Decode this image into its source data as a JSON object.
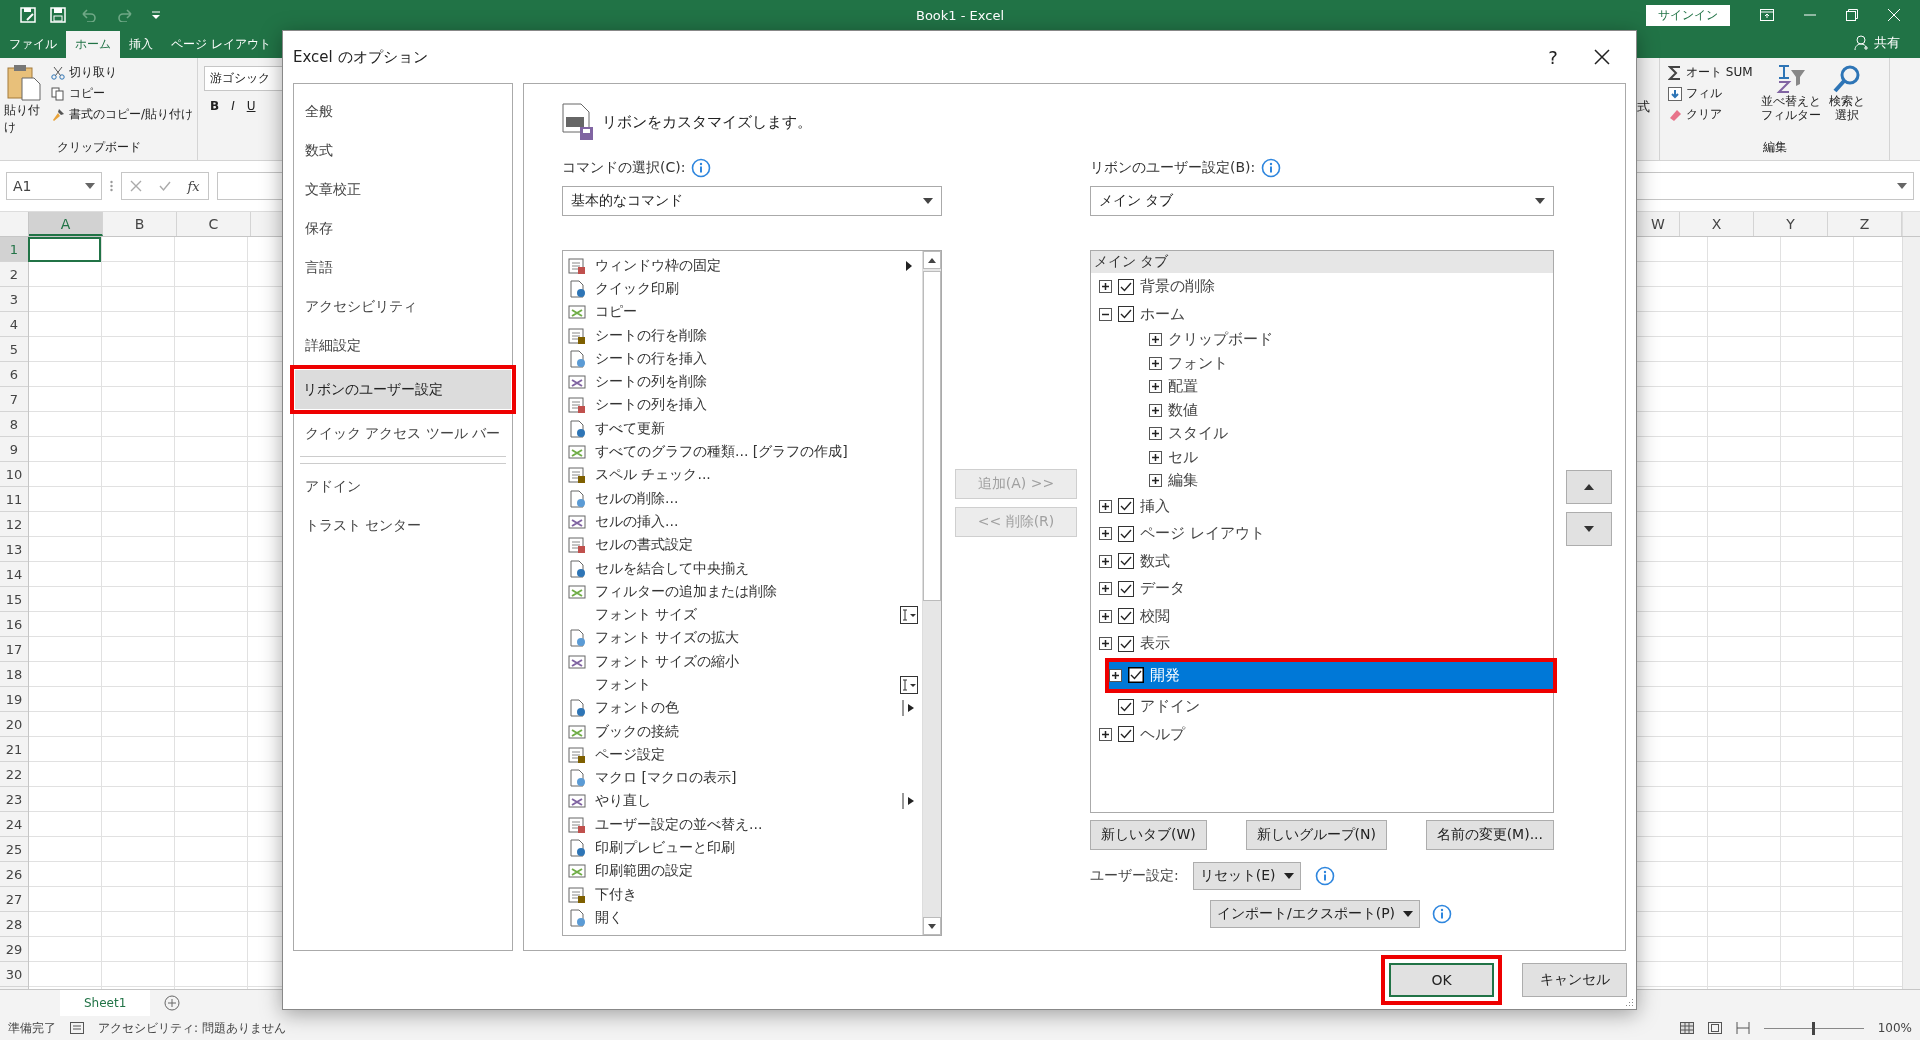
{
  "excel": {
    "title": "Book1  -  Excel",
    "signin": "サインイン",
    "share": "共有",
    "tabs": [
      {
        "label": "ファイル",
        "selected": false
      },
      {
        "label": "ホーム",
        "selected": true
      },
      {
        "label": "挿入",
        "selected": false
      },
      {
        "label": "ページ レイアウト",
        "selected": false
      }
    ],
    "clipboard": {
      "paste": "貼り付け",
      "cut": "切り取り",
      "copy": "コピー",
      "format_painter": "書式のコピー/貼り付け",
      "group": "クリップボード"
    },
    "font": {
      "name": "游ゴシック",
      "bold": "B",
      "italic": "I",
      "underline": "U"
    },
    "cells_fragment": "式",
    "editing": {
      "autosum": "オート SUM",
      "fill": "フィル",
      "clear": "クリア",
      "sort": [
        "並べ替えと",
        "フィルター"
      ],
      "find": [
        "検索と",
        "選択"
      ],
      "group": "編集"
    },
    "name_box": "A1",
    "function_label": "fx",
    "columns_left": [
      "A",
      "B",
      "C"
    ],
    "columns_right": [
      "W",
      "X",
      "Y",
      "Z"
    ],
    "rows": [
      "1",
      "2",
      "3",
      "4",
      "5",
      "6",
      "7",
      "8",
      "9",
      "10",
      "11",
      "12",
      "13",
      "14",
      "15",
      "16",
      "17",
      "18",
      "19",
      "20",
      "21",
      "22",
      "23",
      "24",
      "25",
      "26",
      "27",
      "28",
      "29",
      "30"
    ],
    "sheet_tab": "Sheet1",
    "status": {
      "ready": "準備完了",
      "accessibility": "アクセシビリティ: 問題ありません",
      "zoom": "100%",
      "zoom_slider": {
        "level": 0.5
      }
    }
  },
  "dialog": {
    "title": "Excel のオプション",
    "help": "?",
    "nav": [
      {
        "label": "全般",
        "selected": false,
        "highlighted": false
      },
      {
        "label": "数式",
        "selected": false,
        "highlighted": false
      },
      {
        "label": "文章校正",
        "selected": false,
        "highlighted": false
      },
      {
        "label": "保存",
        "selected": false,
        "highlighted": false
      },
      {
        "label": "言語",
        "selected": false,
        "highlighted": false
      },
      {
        "label": "アクセシビリティ",
        "selected": false,
        "highlighted": false
      },
      {
        "label": "詳細設定",
        "selected": false,
        "highlighted": false
      },
      {
        "label": "リボンのユーザー設定",
        "selected": true,
        "highlighted": true
      },
      {
        "label": "クイック アクセス ツール バー",
        "selected": false,
        "highlighted": false
      },
      {
        "label": "アドイン",
        "selected": false,
        "highlighted": false
      },
      {
        "label": "トラスト センター",
        "selected": false,
        "highlighted": false
      }
    ],
    "heading": "リボンをカスタマイズします。",
    "commands_label": "コマンドの選択(C):",
    "commands_source": "基本的なコマンド",
    "commands": [
      {
        "label": "ウィンドウ枠の固定",
        "icon": true,
        "kind": "submenu"
      },
      {
        "label": "クイック印刷",
        "icon": true
      },
      {
        "label": "コピー",
        "icon": true
      },
      {
        "label": "シートの行を削除",
        "icon": true
      },
      {
        "label": "シートの行を挿入",
        "icon": true
      },
      {
        "label": "シートの列を削除",
        "icon": true
      },
      {
        "label": "シートの列を挿入",
        "icon": true
      },
      {
        "label": "すべて更新",
        "icon": true
      },
      {
        "label": "すべてのグラフの種類... [グラフの作成]",
        "icon": true
      },
      {
        "label": "スペル チェック...",
        "icon": true
      },
      {
        "label": "セルの削除...",
        "icon": true
      },
      {
        "label": "セルの挿入...",
        "icon": true
      },
      {
        "label": "セルの書式設定",
        "icon": true
      },
      {
        "label": "セルを結合して中央揃え",
        "icon": true
      },
      {
        "label": "フィルターの追加または削除",
        "icon": true
      },
      {
        "label": "フォント サイズ",
        "icon": false,
        "kind": "textbox"
      },
      {
        "label": "フォント サイズの拡大",
        "icon": true
      },
      {
        "label": "フォント サイズの縮小",
        "icon": true
      },
      {
        "label": "フォント",
        "icon": false,
        "kind": "textbox"
      },
      {
        "label": "フォントの色",
        "icon": true,
        "kind": "split"
      },
      {
        "label": "ブックの接続",
        "icon": true
      },
      {
        "label": "ページ設定",
        "icon": true
      },
      {
        "label": "マクロ [マクロの表示]",
        "icon": true
      },
      {
        "label": "やり直し",
        "icon": true,
        "kind": "split"
      },
      {
        "label": "ユーザー設定の並べ替え...",
        "icon": true
      },
      {
        "label": "印刷プレビューと印刷",
        "icon": true
      },
      {
        "label": "印刷範囲の設定",
        "icon": true
      },
      {
        "label": "下付き",
        "icon": true
      },
      {
        "label": "開く",
        "icon": true
      }
    ],
    "add_button": {
      "label": "追加(A) >>",
      "disabled": true
    },
    "remove_button": {
      "label": "<< 削除(R)",
      "disabled": true
    },
    "ribbon_label": "リボンのユーザー設定(B):",
    "ribbon_source": "メイン タブ",
    "tree_header": "メイン タブ",
    "tree": [
      {
        "label": "背景の削除",
        "kind": "tab",
        "checked": true,
        "expandable": true,
        "expanded": false,
        "selected": false,
        "highlighted": false
      },
      {
        "label": "ホーム",
        "kind": "tab",
        "checked": true,
        "expandable": true,
        "expanded": true,
        "selected": false,
        "highlighted": false,
        "children": [
          {
            "label": "クリップボード",
            "kind": "group",
            "expandable": true,
            "expanded": false,
            "selected": false,
            "highlighted": false
          },
          {
            "label": "フォント",
            "kind": "group",
            "expandable": true,
            "expanded": false,
            "selected": false,
            "highlighted": false
          },
          {
            "label": "配置",
            "kind": "group",
            "expandable": true,
            "expanded": false,
            "selected": false,
            "highlighted": false
          },
          {
            "label": "数値",
            "kind": "group",
            "expandable": true,
            "expanded": false,
            "selected": false,
            "highlighted": false
          },
          {
            "label": "スタイル",
            "kind": "group",
            "expandable": true,
            "expanded": false,
            "selected": false,
            "highlighted": false
          },
          {
            "label": "セル",
            "kind": "group",
            "expandable": true,
            "expanded": false,
            "selected": false,
            "highlighted": false
          },
          {
            "label": "編集",
            "kind": "group",
            "expandable": true,
            "expanded": false,
            "selected": false,
            "highlighted": false
          }
        ]
      },
      {
        "label": "挿入",
        "kind": "tab",
        "checked": true,
        "expandable": true,
        "expanded": false,
        "selected": false,
        "highlighted": false
      },
      {
        "label": "ページ レイアウト",
        "kind": "tab",
        "checked": true,
        "expandable": true,
        "expanded": false,
        "selected": false,
        "highlighted": false
      },
      {
        "label": "数式",
        "kind": "tab",
        "checked": true,
        "expandable": true,
        "expanded": false,
        "selected": false,
        "highlighted": false
      },
      {
        "label": "データ",
        "kind": "tab",
        "checked": true,
        "expandable": true,
        "expanded": false,
        "selected": false,
        "highlighted": false
      },
      {
        "label": "校閲",
        "kind": "tab",
        "checked": true,
        "expandable": true,
        "expanded": false,
        "selected": false,
        "highlighted": false
      },
      {
        "label": "表示",
        "kind": "tab",
        "checked": true,
        "expandable": true,
        "expanded": false,
        "selected": false,
        "highlighted": false
      },
      {
        "label": "開発",
        "kind": "tab",
        "checked": true,
        "expandable": true,
        "expanded": false,
        "selected": true,
        "highlighted": true
      },
      {
        "label": "アドイン",
        "kind": "tab",
        "checked": true,
        "expandable": false,
        "expanded": false,
        "selected": false,
        "highlighted": false
      },
      {
        "label": "ヘルプ",
        "kind": "tab",
        "checked": true,
        "expandable": true,
        "expanded": false,
        "selected": false,
        "highlighted": false
      }
    ],
    "tree_buttons": [
      "新しいタブ(W)",
      "新しいグループ(N)",
      "名前の変更(M)..."
    ],
    "customizations_label": "ユーザー設定:",
    "reset": "リセット(E)",
    "import_export": "インポート/エクスポート(P)",
    "buttons": [
      {
        "label": "OK",
        "default": true,
        "highlighted": true
      },
      {
        "label": "キャンセル",
        "default": false,
        "highlighted": false
      }
    ]
  }
}
